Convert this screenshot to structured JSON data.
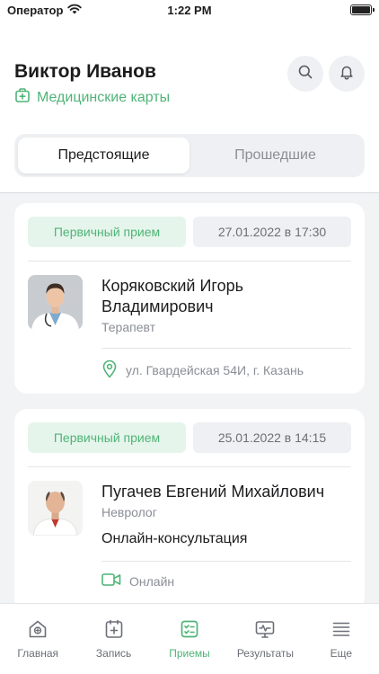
{
  "status_bar": {
    "carrier": "Оператор",
    "time": "1:22 PM"
  },
  "header": {
    "user_name": "Виктор Иванов",
    "med_cards_label": "Медицинские карты"
  },
  "segments": {
    "upcoming": "Предстоящие",
    "past": "Прошедшие",
    "active": "upcoming"
  },
  "appointments": [
    {
      "type": "Первичный прием",
      "datetime": "27.01.2022 в 17:30",
      "doctor": "Коряковский Игорь Владимирович",
      "specialty": "Терапевт",
      "address": "ул. Гвардейская 54И, г. Казань"
    },
    {
      "type": "Первичный прием",
      "datetime": "25.01.2022 в 14:15",
      "doctor": "Пугачев Евгений Михайлович",
      "specialty": "Невролог",
      "consultation": "Онлайн-консультация",
      "location": "Онлайн"
    }
  ],
  "tabbar": {
    "home": "Главная",
    "booking": "Запись",
    "appointments": "Приемы",
    "results": "Результаты",
    "more": "Еще"
  },
  "colors": {
    "accent": "#4fb477",
    "accent_bg": "#e6f5ec",
    "muted": "#8a8e95"
  },
  "icons": [
    "wifi-icon",
    "battery-icon",
    "medical-card-icon",
    "search-icon",
    "bell-icon",
    "location-pin-icon",
    "video-camera-icon",
    "home-icon",
    "booking-icon",
    "appointments-icon",
    "results-icon",
    "menu-icon"
  ]
}
